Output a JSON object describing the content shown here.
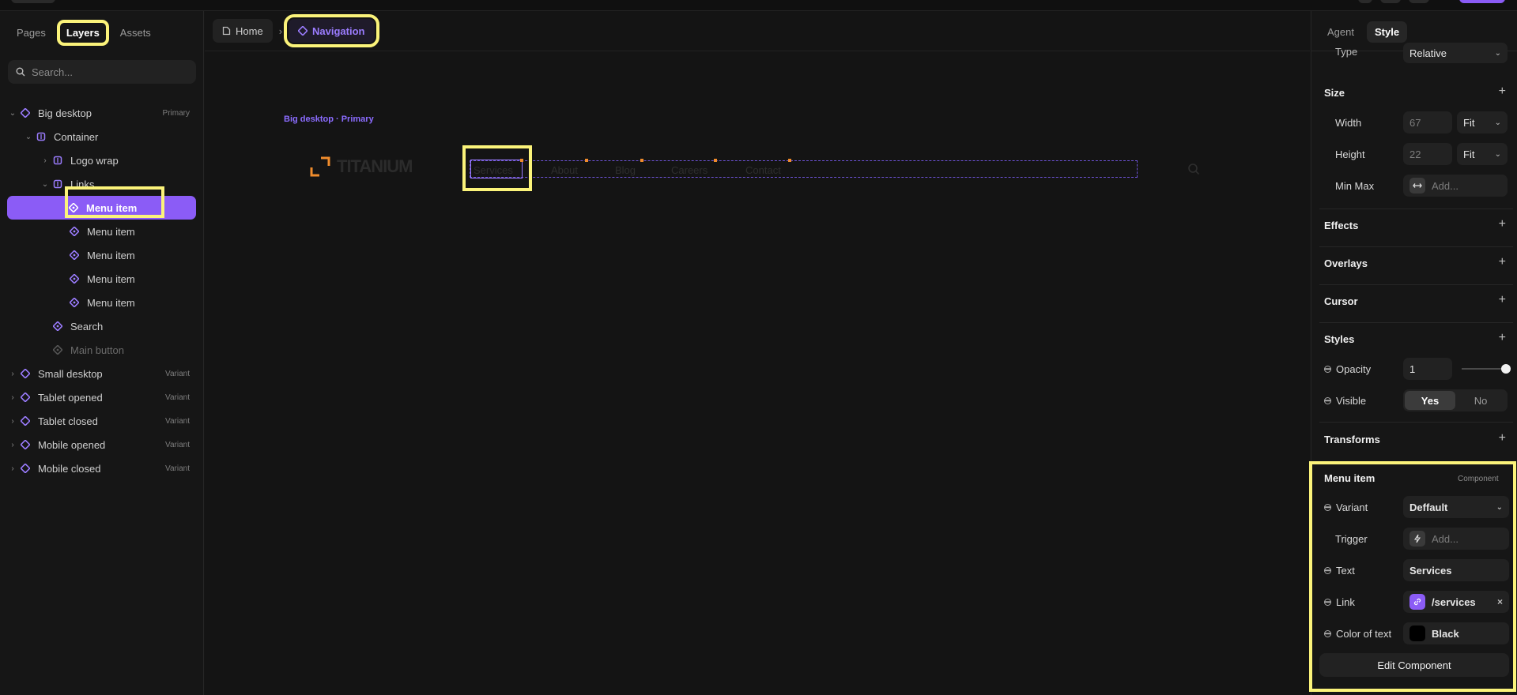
{
  "left_panel": {
    "tabs": [
      "Pages",
      "Layers",
      "Assets"
    ],
    "active_tab": "Layers",
    "search_placeholder": "Search...",
    "layers": [
      {
        "label": "Big desktop",
        "tag": "Primary"
      },
      {
        "label": "Container"
      },
      {
        "label": "Logo wrap"
      },
      {
        "label": "Links"
      },
      {
        "label": "Menu item"
      },
      {
        "label": "Menu item"
      },
      {
        "label": "Menu item"
      },
      {
        "label": "Menu item"
      },
      {
        "label": "Menu item"
      },
      {
        "label": "Search"
      },
      {
        "label": "Main button"
      },
      {
        "label": "Small desktop",
        "tag": "Variant"
      },
      {
        "label": "Tablet opened",
        "tag": "Variant"
      },
      {
        "label": "Tablet closed",
        "tag": "Variant"
      },
      {
        "label": "Mobile opened",
        "tag": "Variant"
      },
      {
        "label": "Mobile closed",
        "tag": "Variant"
      }
    ]
  },
  "canvas": {
    "breadcrumb": {
      "home": "Home",
      "current": "Navigation"
    },
    "frame_label": "Big desktop · Primary",
    "logo_text": "TITANIUM",
    "nav_links": [
      "Services",
      "About",
      "Blog",
      "Careers",
      "Contact"
    ]
  },
  "right_panel": {
    "tabs": [
      "Agent",
      "Style"
    ],
    "active_tab": "Style",
    "position": {
      "label": "Type",
      "value": "Relative"
    },
    "size": {
      "heading": "Size",
      "width_label": "Width",
      "width_value": "67",
      "width_mode": "Fit",
      "height_label": "Height",
      "height_value": "22",
      "height_mode": "Fit",
      "minmax_label": "Min Max",
      "minmax_placeholder": "Add..."
    },
    "sections": {
      "effects": "Effects",
      "overlays": "Overlays",
      "cursor": "Cursor",
      "styles": "Styles",
      "transforms": "Transforms"
    },
    "styles": {
      "opacity_label": "Opacity",
      "opacity_value": "1",
      "visible_label": "Visible",
      "visible_yes": "Yes",
      "visible_no": "No"
    },
    "component": {
      "title": "Menu item",
      "tag": "Component",
      "variant_label": "Variant",
      "variant_value": "Deffault",
      "trigger_label": "Trigger",
      "trigger_placeholder": "Add...",
      "text_label": "Text",
      "text_value": "Services",
      "link_label": "Link",
      "link_value": "/services",
      "color_label": "Color of text",
      "color_value": "Black",
      "edit_button": "Edit Component"
    }
  },
  "colors": {
    "accent": "#8b5cf6",
    "highlight": "#fbf37a",
    "logo_orange": "#f08c2c"
  }
}
